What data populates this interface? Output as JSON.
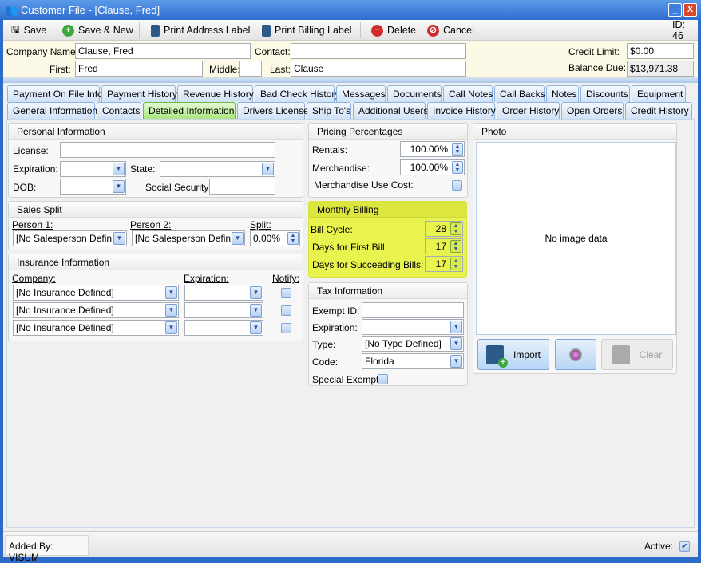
{
  "window": {
    "title": "Customer File - [Clause, Fred]",
    "minimize": "_",
    "close": "X"
  },
  "toolbar": {
    "save": "Save",
    "save_new": "Save & New",
    "print_address": "Print Address Label",
    "print_billing": "Print Billing Label",
    "delete": "Delete",
    "cancel": "Cancel",
    "id_label": "ID: 46"
  },
  "header": {
    "company_label": "Company Name:",
    "company": "Clause, Fred",
    "contact_label": "Contact:",
    "contact": "",
    "first_label": "First:",
    "first": "Fred",
    "middle_label": "Middle:",
    "middle": "",
    "last_label": "Last:",
    "last": "Clause",
    "credit_limit_label": "Credit Limit:",
    "credit_limit": "$0.00",
    "balance_due_label": "Balance Due:",
    "balance_due": "$13,971.38"
  },
  "tabs": {
    "row1": [
      "Payment On File Info",
      "Payment History",
      "Revenue History",
      "Bad Check History",
      "Messages",
      "Documents",
      "Call Notes",
      "Call Backs",
      "Notes",
      "Discounts",
      "Equipment"
    ],
    "row2": [
      "General Information",
      "Contacts",
      "Detailed Information",
      "Drivers License",
      "Ship To's",
      "Additional Users",
      "Invoice History",
      "Order History",
      "Open Orders",
      "Credit History"
    ],
    "active": "Detailed Information"
  },
  "personal": {
    "title": "Personal Information",
    "license_label": "License:",
    "license": "",
    "expiration_label": "Expiration:",
    "expiration": "",
    "state_label": "State:",
    "state": "",
    "dob_label": "DOB:",
    "dob": "",
    "ssn_label": "Social Security:",
    "ssn": ""
  },
  "sales_split": {
    "title": "Sales Split",
    "person1_label": "Person 1:",
    "person1": "[No Salesperson Defin...",
    "person2_label": "Person 2:",
    "person2": "[No Salesperson Defin...",
    "split_label": "Split:",
    "split": "0.00%"
  },
  "insurance": {
    "title": "Insurance Information",
    "company_label": "Company:",
    "expiration_label": "Expiration:",
    "notify_label": "Notify:",
    "rows": [
      {
        "company": "[No Insurance Defined]",
        "expiration": "",
        "notify": false
      },
      {
        "company": "[No Insurance Defined]",
        "expiration": "",
        "notify": false
      },
      {
        "company": "[No Insurance Defined]",
        "expiration": "",
        "notify": false
      }
    ]
  },
  "pricing": {
    "title": "Pricing Percentages",
    "rentals_label": "Rentals:",
    "rentals": "100.00%",
    "merch_label": "Merchandise:",
    "merch": "100.00%",
    "use_cost_label": "Merchandise Use Cost:",
    "use_cost": false
  },
  "billing": {
    "title": "Monthly Billing",
    "bill_cycle_label": "Bill Cycle:",
    "bill_cycle": "28",
    "first_label": "Days for First Bill:",
    "first": "17",
    "succ_label": "Days for Succeeding Bills:",
    "succ": "17",
    "highlight": "#e8f34e"
  },
  "tax": {
    "title": "Tax Information",
    "exempt_id_label": "Exempt ID:",
    "exempt_id": "",
    "expiration_label": "Expiration:",
    "expiration": "",
    "type_label": "Type:",
    "type": "[No Type Defined]",
    "code_label": "Code:",
    "code": "Florida",
    "special_label": "Special Exempt:",
    "special": false
  },
  "photo": {
    "title": "Photo",
    "empty": "No image data",
    "import": "Import",
    "clear": "Clear"
  },
  "status": {
    "added_by": "Added By: VISUM",
    "active_label": "Active:",
    "active": true
  }
}
